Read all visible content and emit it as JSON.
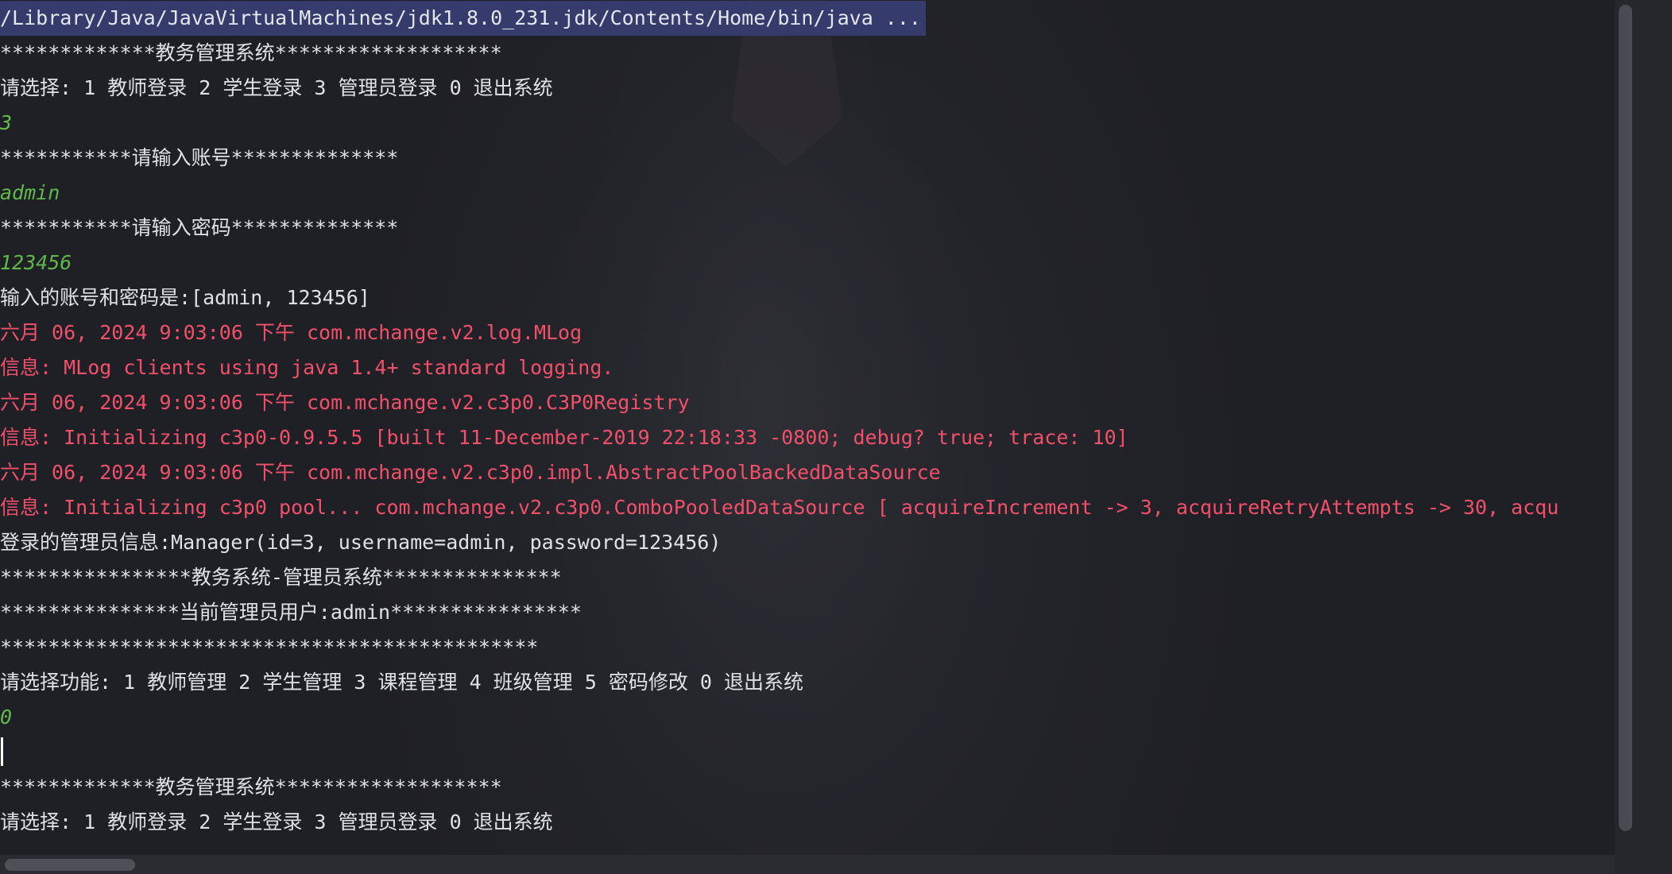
{
  "console": {
    "lines": [
      {
        "kind": "cmd",
        "text": "/Library/Java/JavaVirtualMachines/jdk1.8.0_231.jdk/Contents/Home/bin/java ..."
      },
      {
        "kind": "out",
        "text": "*************教务管理系统*******************"
      },
      {
        "kind": "out",
        "text": "请选择: 1 教师登录 2 学生登录 3 管理员登录 0 退出系统"
      },
      {
        "kind": "input",
        "text": "3"
      },
      {
        "kind": "out",
        "text": "***********请输入账号**************"
      },
      {
        "kind": "input",
        "text": "admin"
      },
      {
        "kind": "out",
        "text": "***********请输入密码**************"
      },
      {
        "kind": "input",
        "text": "123456"
      },
      {
        "kind": "out",
        "text": "输入的账号和密码是:[admin, 123456]"
      },
      {
        "kind": "err",
        "text": "六月 06, 2024 9:03:06 下午 com.mchange.v2.log.MLog"
      },
      {
        "kind": "err",
        "text": "信息: MLog clients using java 1.4+ standard logging."
      },
      {
        "kind": "err",
        "text": "六月 06, 2024 9:03:06 下午 com.mchange.v2.c3p0.C3P0Registry"
      },
      {
        "kind": "err",
        "text": "信息: Initializing c3p0-0.9.5.5 [built 11-December-2019 22:18:33 -0800; debug? true; trace: 10]"
      },
      {
        "kind": "err",
        "text": "六月 06, 2024 9:03:06 下午 com.mchange.v2.c3p0.impl.AbstractPoolBackedDataSource"
      },
      {
        "kind": "err",
        "text": "信息: Initializing c3p0 pool... com.mchange.v2.c3p0.ComboPooledDataSource [ acquireIncrement -> 3, acquireRetryAttempts -> 30, acqu"
      },
      {
        "kind": "out",
        "text": "登录的管理员信息:Manager(id=3, username=admin, password=123456)"
      },
      {
        "kind": "out",
        "text": "****************教务系统-管理员系统***************"
      },
      {
        "kind": "out",
        "text": "***************当前管理员用户:admin****************"
      },
      {
        "kind": "out",
        "text": "*********************************************"
      },
      {
        "kind": "out",
        "text": "请选择功能: 1 教师管理 2 学生管理 3 课程管理 4 班级管理 5 密码修改 0 退出系统"
      },
      {
        "kind": "input",
        "text": "0"
      },
      {
        "kind": "blank",
        "text": ""
      },
      {
        "kind": "out",
        "text": "*************教务管理系统*******************"
      },
      {
        "kind": "out",
        "text": "请选择: 1 教师登录 2 学生登录 3 管理员登录 0 退出系统"
      }
    ]
  },
  "colors": {
    "background": "#23242a",
    "command_highlight": "#353b6b",
    "output_text": "#dfe1e5",
    "user_input": "#5fb84a",
    "stderr": "#f2506a"
  }
}
